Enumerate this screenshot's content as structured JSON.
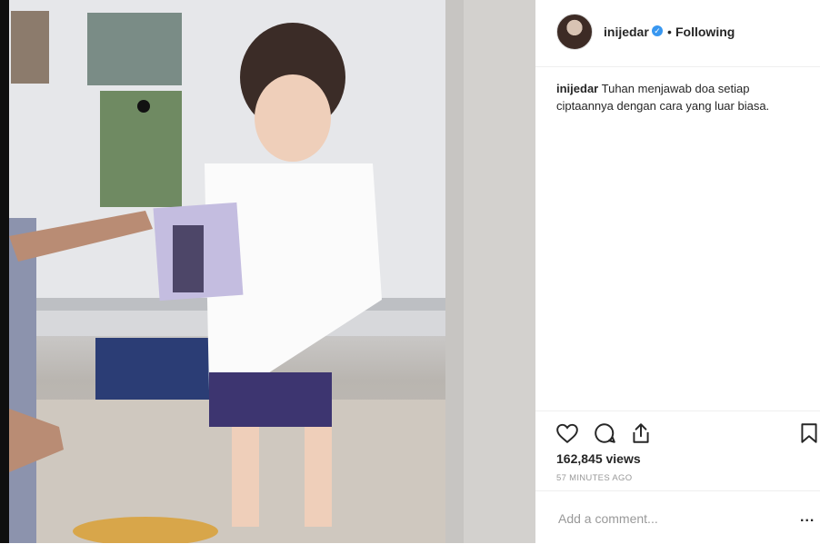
{
  "post": {
    "username": "inijedar",
    "verified_icon": "verified-badge-icon",
    "dot": "•",
    "follow_status": "Following",
    "caption_user": "inijedar",
    "caption_text": "Tuhan menjawab doa setiap ciptaannya dengan cara yang luar biasa.",
    "views": "162,845 views",
    "time": "57 MINUTES AGO",
    "comment_placeholder": "Add a comment...",
    "more": "..."
  },
  "icons": {
    "like": "heart-icon",
    "comment": "comment-icon",
    "share": "share-icon",
    "save": "bookmark-icon"
  },
  "colors": {
    "verified": "#3897f0",
    "text": "#262626",
    "muted": "#999999"
  }
}
